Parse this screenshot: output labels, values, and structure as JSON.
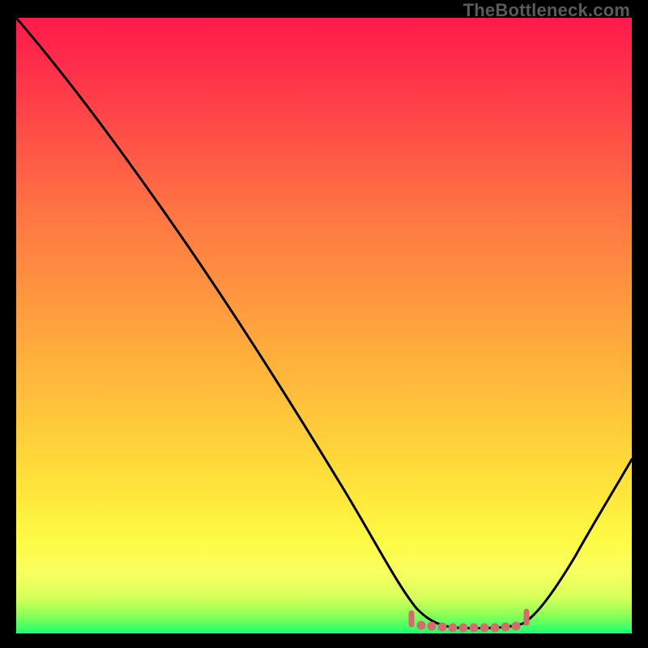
{
  "watermark": "TheBottleneck.com",
  "chart_data": {
    "type": "line",
    "title": "",
    "xlabel": "",
    "ylabel": "",
    "xlim": [
      0,
      100
    ],
    "ylim": [
      0,
      100
    ],
    "series": [
      {
        "name": "curve",
        "color": "#000000",
        "x": [
          0,
          5,
          10,
          15,
          20,
          25,
          30,
          35,
          40,
          45,
          50,
          55,
          60,
          63,
          65,
          68,
          72,
          76,
          80,
          82,
          85,
          88,
          92,
          96,
          100
        ],
        "y": [
          100,
          94,
          88,
          81,
          73,
          65,
          57,
          49,
          41,
          33,
          25,
          17,
          10,
          6,
          4,
          2,
          1,
          1,
          1,
          2,
          4,
          8,
          14,
          21,
          28
        ]
      },
      {
        "name": "bottleneck-band",
        "color": "#d66b6b",
        "x": [
          63,
          82
        ],
        "y": [
          2,
          2
        ]
      }
    ],
    "gradient_stops": [
      {
        "pos": 0,
        "color": "#ff1a4b"
      },
      {
        "pos": 8,
        "color": "#ff2f4a"
      },
      {
        "pos": 20,
        "color": "#ff5246"
      },
      {
        "pos": 32,
        "color": "#ff7644"
      },
      {
        "pos": 44,
        "color": "#ff9340"
      },
      {
        "pos": 56,
        "color": "#ffb13c"
      },
      {
        "pos": 68,
        "color": "#ffcf3a"
      },
      {
        "pos": 78,
        "color": "#ffe83b"
      },
      {
        "pos": 85,
        "color": "#fdfb46"
      },
      {
        "pos": 90,
        "color": "#f9ff60"
      },
      {
        "pos": 94,
        "color": "#d9ff5a"
      },
      {
        "pos": 97,
        "color": "#8dff57"
      },
      {
        "pos": 100,
        "color": "#1aff70"
      }
    ]
  }
}
